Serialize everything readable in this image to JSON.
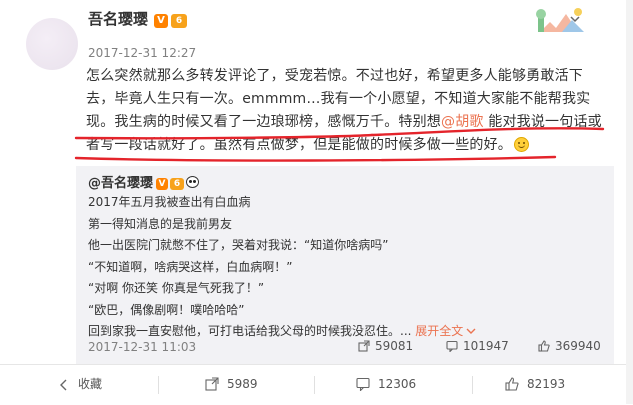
{
  "post": {
    "username": "吾名璎璎",
    "timestamp": "2017-12-31 12:27",
    "badges": {
      "verified": "V",
      "level": "6"
    },
    "text_main": "怎么突然就那么多转发评论了，受宠若惊。不过也好，希望更多人能够勇敢活下去，毕竟人生只有一次。emmmm…我有一个小愿望，不知道大家能不能帮我实现。我生病的时候又看了一边琅琊榜，感慨万千。特别想",
    "mention": "@胡歌",
    "text_tail": " 能对我说一句话或者写一段话就好了。虽然有点做梦，但是能做的时候多做一些的好。",
    "emoji": "smile-emoji"
  },
  "repost": {
    "author": "@吾名璎璎",
    "badges": {
      "verified": "V",
      "level": "6"
    },
    "lines": [
      "2017年五月我被查出有白血病",
      "第一得知消息的是我前男友",
      "他一出医院门就憋不住了，哭着对我说：“知道你啥病吗”",
      "“不知道啊，啥病哭这样，白血病啊！”",
      "“对啊 你还笑 你真是气死我了！”",
      "“欧巴，偶像剧啊！噗哈哈哈”",
      "回到家我一直安慰他，可打电话给我父母的时候我没忍住。..."
    ],
    "expand_label": "展开全文",
    "timestamp": "2017-12-31 11:03",
    "stats": {
      "reposts": "59081",
      "comments": "101947",
      "likes": "369940"
    }
  },
  "actions": {
    "favorite": "收藏",
    "repost": "5989",
    "comment": "12306",
    "like": "82193"
  },
  "colors": {
    "accent": "#eb7350",
    "verified_badge": "#ff8200",
    "annotation_underline": "#e4242b",
    "repost_bg": "#f2f2f5"
  },
  "icons": [
    "dropdown-chevron-icon",
    "share-icon",
    "comment-icon",
    "thumbs-up-icon",
    "favorite-icon",
    "panda-icon",
    "smile-emoji"
  ]
}
